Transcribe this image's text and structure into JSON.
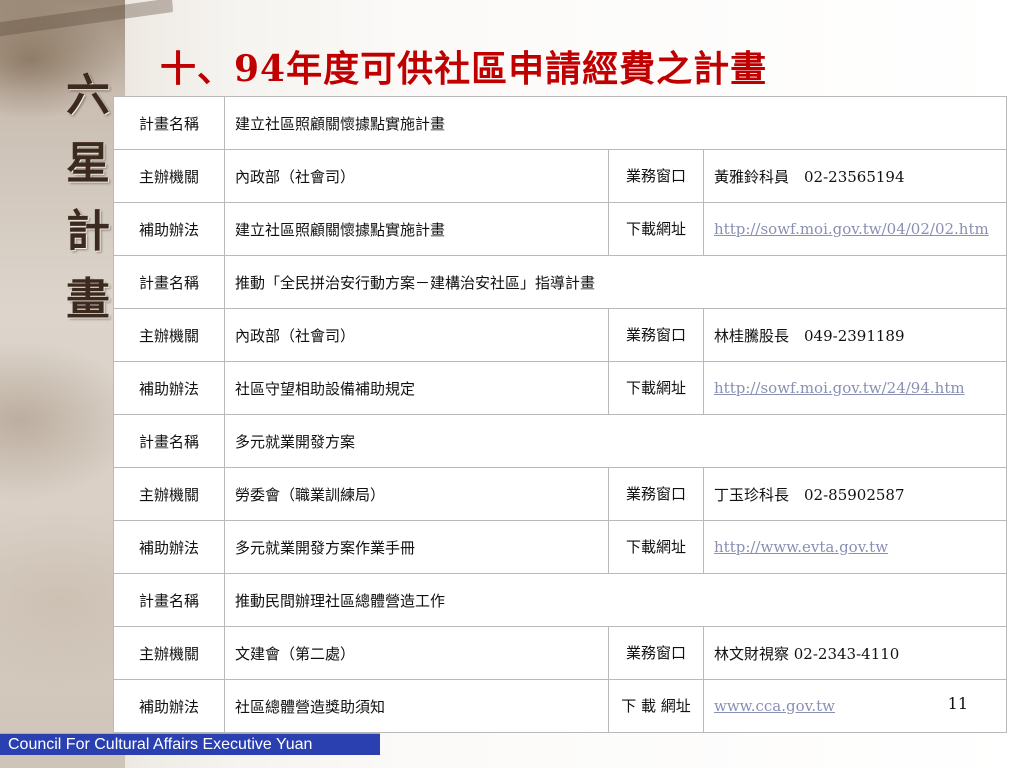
{
  "side_title": [
    "六",
    "星",
    "計",
    "畫"
  ],
  "slide_title": "十、94年度可供社區申請經費之計畫",
  "rows": [
    {
      "type": "plan",
      "label": "計畫名稱",
      "value": "建立社區照顧關懷據點實施計畫"
    },
    {
      "type": "org",
      "label": "主辦機關",
      "value": "內政部（社會司）",
      "sub_label": "業務窗口",
      "info": "黃雅鈴科員　02-23565194"
    },
    {
      "type": "link",
      "label": "補助辦法",
      "value": "建立社區照顧關懷據點實施計畫",
      "sub_label": "下載網址",
      "link": "http://sowf.moi.gov.tw/04/02/02.htm"
    },
    {
      "type": "plan",
      "label": "計畫名稱",
      "value": "推動「全民拼治安行動方案－建構治安社區」指導計畫"
    },
    {
      "type": "org",
      "label": "主辦機關",
      "value": "內政部（社會司）",
      "sub_label": "業務窗口",
      "info": "林桂騰股長　049-2391189"
    },
    {
      "type": "link",
      "label": "補助辦法",
      "value": "社區守望相助設備補助規定",
      "sub_label": "下載網址",
      "link": "http://sowf.moi.gov.tw/24/94.htm"
    },
    {
      "type": "plan",
      "label": "計畫名稱",
      "value": "多元就業開發方案"
    },
    {
      "type": "org",
      "label": "主辦機關",
      "value": "勞委會（職業訓練局）",
      "sub_label": "業務窗口",
      "info": "丁玉珍科長　02-85902587"
    },
    {
      "type": "link",
      "label": "補助辦法",
      "value": "多元就業開發方案作業手冊",
      "sub_label": "下載網址",
      "link": "http://www.evta.gov.tw"
    },
    {
      "type": "plan",
      "label": "計畫名稱",
      "value": "推動民間辦理社區總體營造工作"
    },
    {
      "type": "org",
      "label": "主辦機關",
      "value": "文建會（第二處）",
      "sub_label": "業務窗口",
      "info": "林文財視察  02-2343-4110"
    },
    {
      "type": "link",
      "label": "補助辦法",
      "value": "社區總體營造獎助須知",
      "sub_label": "下 載 網址",
      "link": "www.cca.gov.tw"
    }
  ],
  "page_number": "11",
  "footer": "Council For Cultural Affairs Executive Yuan",
  "colors": {
    "title": "#c00000",
    "highlight": "#2e8b22",
    "link": "#8a8fb4",
    "footer_bg": "#2a3fb0"
  }
}
